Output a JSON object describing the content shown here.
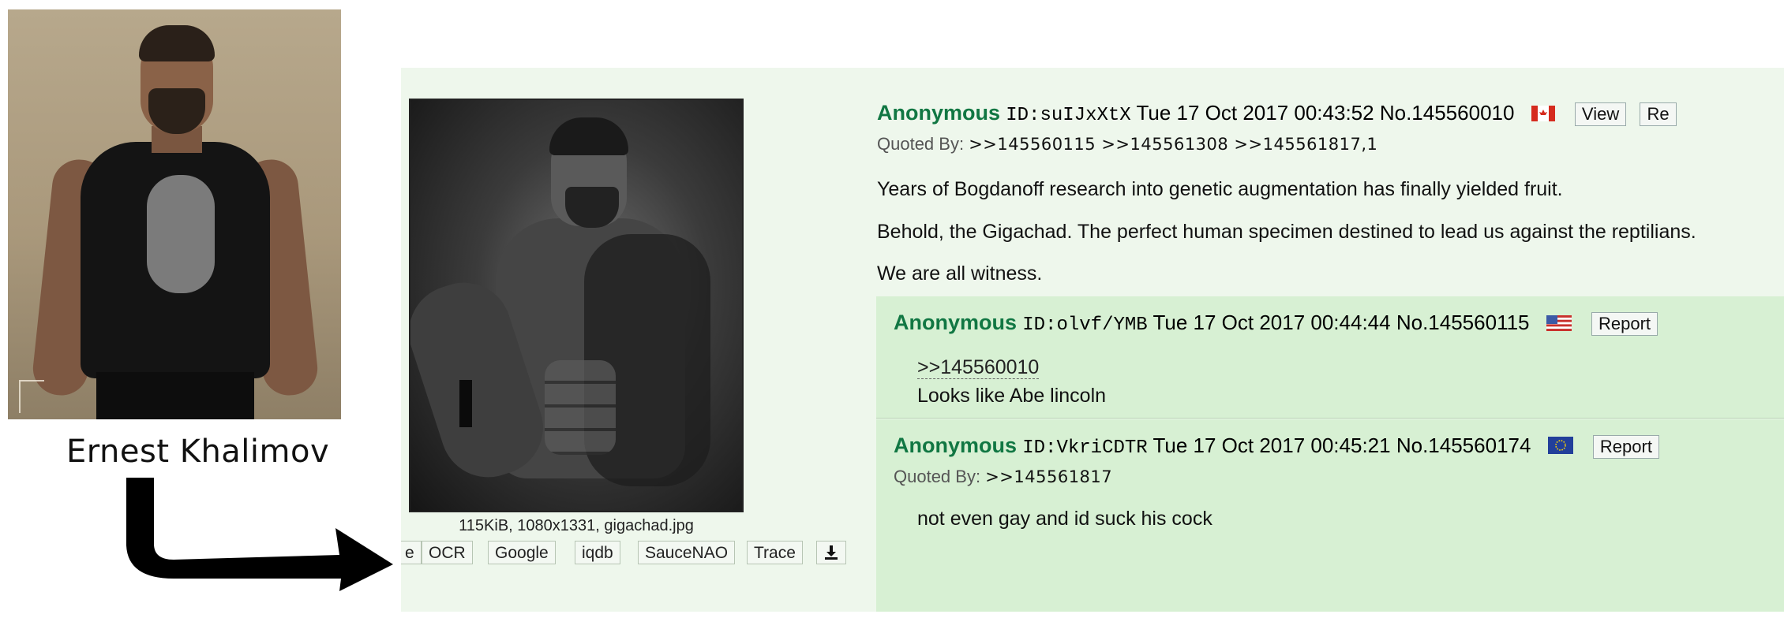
{
  "photo": {
    "caption": "Ernest Khalimov"
  },
  "op": {
    "name": "Anonymous",
    "id": "ID:suIJxXtX",
    "datetime": "Tue 17 Oct 2017 00:43:52",
    "number": "No.145560010",
    "flag_icon": "canada-flag-icon",
    "view_label": "View",
    "report_label_cut": "Re",
    "quoted_by_label": "Quoted By:",
    "quoted_by_links": ">>145560115 >>145561308 >>145561817,1",
    "body": [
      "Years of Bogdanoff research into genetic augmentation has finally yielded fruit.",
      "Behold, the Gigachad. The perfect human specimen destined to lead us against the reptilians.",
      "We are all witness."
    ],
    "file_info": "115KiB, 1080x1331, gigachad.jpg",
    "file_buttons": [
      "e",
      "OCR",
      "Google",
      "iqdb",
      "SauceNAO",
      "Trace"
    ],
    "download_icon": "download-icon"
  },
  "replies": [
    {
      "name": "Anonymous",
      "id": "ID:olvf/YMB",
      "datetime": "Tue 17 Oct 2017 00:44:44",
      "number": "No.145560115",
      "flag_icon": "usa-flag-icon",
      "report_label": "Report",
      "quote_link": ">>145560010",
      "body": "Looks like Abe lincoln"
    },
    {
      "name": "Anonymous",
      "id": "ID:VkriCDTR",
      "datetime": "Tue 17 Oct 2017 00:45:21",
      "number": "No.145560174",
      "flag_icon": "eu-flag-icon",
      "report_label": "Report",
      "quoted_by_label": "Quoted By:",
      "quoted_by_links": ">>145561817",
      "body": "not even gay and id suck his cock"
    }
  ],
  "colors": {
    "panel_bg": "#eef7ec",
    "reply_bg": "#d7f0d3",
    "name_green": "#117743"
  }
}
